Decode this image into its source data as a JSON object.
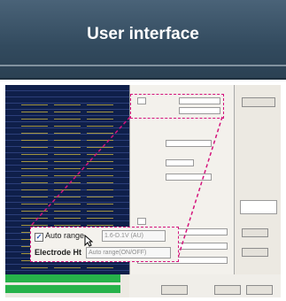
{
  "header": {
    "title": "User interface"
  },
  "zoom": {
    "auto_range_label": "Auto range",
    "auto_range_checked": true,
    "auto_range_value": "1.6-D.1V (AU)",
    "electrode_label": "Electrode Ht",
    "electrode_value": "Auto range(ON/OFF)"
  },
  "colors": {
    "header_bg": "#324a5e",
    "highlight": "#d4147c",
    "console_bg": "#0f1f4a",
    "status_green": "#27b24a"
  },
  "icons": [
    "checkbox-icon",
    "mouse-cursor-icon"
  ]
}
